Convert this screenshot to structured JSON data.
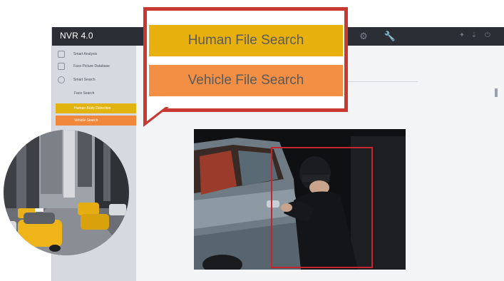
{
  "window": {
    "title": "NVR 4.0"
  },
  "sidebar": {
    "items": [
      {
        "label": "Smart Analysis",
        "icon": "analysis-icon"
      },
      {
        "label": "Face Picture Database",
        "icon": "database-icon"
      },
      {
        "label": "Smart Search",
        "icon": "search-icon"
      }
    ],
    "sub_items": [
      {
        "label": "Face Search"
      },
      {
        "label": "Human Body Detection"
      },
      {
        "label": "Vehicle Search"
      }
    ]
  },
  "callout": {
    "options": [
      {
        "label": "Human File Search",
        "color": "#e8b00c"
      },
      {
        "label": "Vehicle File Search",
        "color": "#f28f44"
      }
    ]
  },
  "colors": {
    "accent_red": "#c83a31",
    "topbar": "#2b2e35"
  }
}
